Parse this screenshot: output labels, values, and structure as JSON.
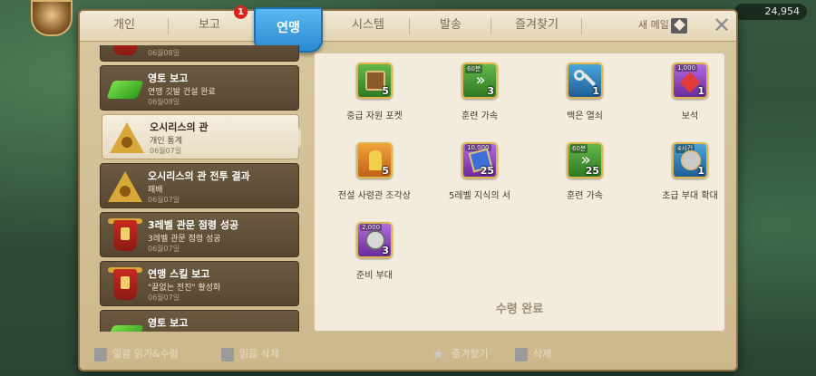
{
  "hud": {
    "resource_value": "24,954"
  },
  "tabs": [
    {
      "label": "개인"
    },
    {
      "label": "보고"
    },
    {
      "label": "연맹"
    },
    {
      "label": "시스템"
    },
    {
      "label": "발송"
    },
    {
      "label": "즐겨찾기"
    }
  ],
  "tab_badge": "1",
  "header": {
    "new_mail": "새 메일"
  },
  "mail_list": [
    {
      "title": "",
      "sub": "",
      "date": "06월08일"
    },
    {
      "title": "영토 보고",
      "sub": "연맹 깃발 건설 완료",
      "date": "06월08일"
    },
    {
      "title": "오시리스의 관",
      "sub": "개인 통계",
      "date": "06월07일"
    },
    {
      "title": "오시리스의 관 전투 결과",
      "sub": "패배",
      "date": "06월07일"
    },
    {
      "title": "3레벨 관문 점령 성공",
      "sub": "3레벨 관문 점령 성공",
      "date": "06월07일"
    },
    {
      "title": "연맹 스킬 보고",
      "sub": "\"끝없는 전진\" 활성화",
      "date": "06월07일"
    },
    {
      "title": "영토 보고",
      "sub": "",
      "date": ""
    }
  ],
  "rewards": [
    {
      "label": "중급 자원 포켓",
      "count": "5",
      "top": "",
      "icon": "resource-chest-icon",
      "bg": "bg-green"
    },
    {
      "label": "훈련 가속",
      "count": "3",
      "top": "60분",
      "icon": "training-speedup-icon",
      "bg": "bg-green"
    },
    {
      "label": "백은 열쇠",
      "count": "1",
      "top": "",
      "icon": "silver-key-icon",
      "bg": "bg-blue"
    },
    {
      "label": "보석",
      "count": "1",
      "top": "1,000",
      "icon": "gem-icon",
      "bg": "bg-purple"
    },
    {
      "label": "전설 사령관 조각상",
      "count": "5",
      "top": "",
      "icon": "commander-statue-icon",
      "bg": "bg-orange"
    },
    {
      "label": "5레벨 지식의 서",
      "count": "25",
      "top": "10,000",
      "icon": "knowledge-book-icon",
      "bg": "bg-purple"
    },
    {
      "label": "훈련 가속",
      "count": "25",
      "top": "60분",
      "icon": "training-speedup-icon",
      "bg": "bg-green"
    },
    {
      "label": "초급 부대 확대",
      "count": "1",
      "top": "4시간",
      "icon": "army-expansion-icon",
      "bg": "bg-blue"
    },
    {
      "label": "준비 부대",
      "count": "3",
      "top": "2,000",
      "icon": "reserve-troops-icon",
      "bg": "bg-purple"
    }
  ],
  "claimed_label": "수령 완료",
  "bottom": {
    "read_all": "일괄 읽기&수령",
    "delete_read": "읽음 삭제",
    "favorite": "즐겨찾기",
    "delete": "삭제"
  }
}
